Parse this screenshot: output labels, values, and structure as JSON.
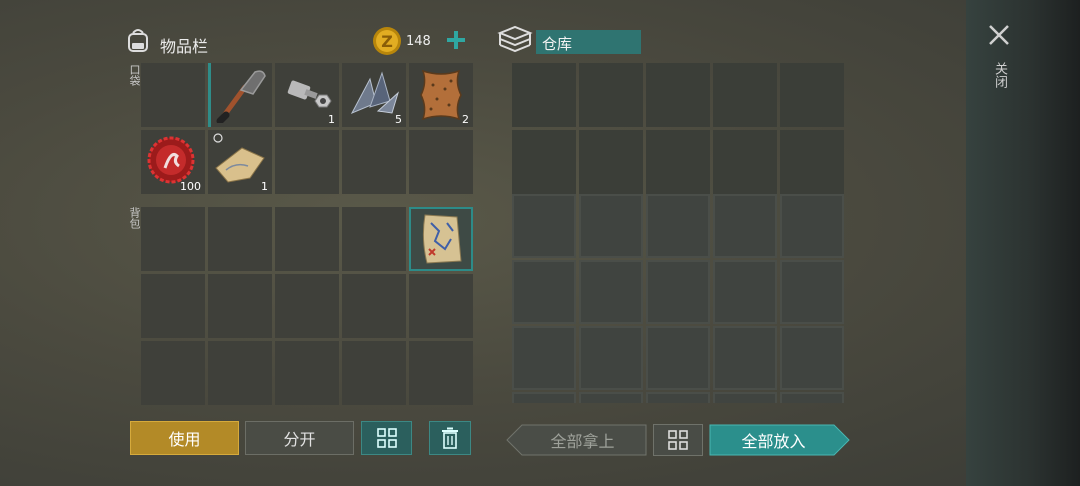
{
  "inventory": {
    "title": "物品栏",
    "coins": "148",
    "pocket_label": "口袋",
    "backpack_label": "背包",
    "items": {
      "bolts_count": "1",
      "crystals_count": "5",
      "leather_count": "2",
      "bottlecap_count": "100",
      "map_piece_count": "1"
    }
  },
  "storage": {
    "title": "仓库"
  },
  "close": {
    "label": "关闭"
  },
  "buttons": {
    "use": "使用",
    "split": "分开",
    "take_all": "全部拿上",
    "put_all": "全部放入"
  },
  "colors": {
    "accent_teal": "#2b8f8c",
    "use_button": "#b38a27",
    "coin": "#e0a81c"
  }
}
